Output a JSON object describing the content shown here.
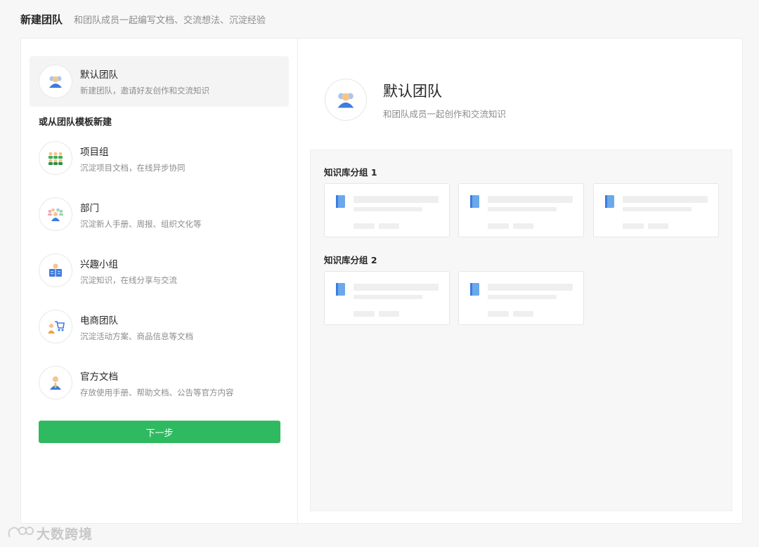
{
  "header": {
    "title": "新建团队",
    "subtitle": "和团队成员一起编写文档、交流想法、沉淀经验"
  },
  "default_team": {
    "title": "默认团队",
    "desc": "新建团队，邀请好友创作和交流知识",
    "icon": "team-icon"
  },
  "templates_label": "或从团队模板新建",
  "templates": [
    {
      "title": "项目组",
      "desc": "沉淀项目文档，在线异步协同",
      "icon": "project-group-icon"
    },
    {
      "title": "部门",
      "desc": "沉淀新人手册、周报、组织文化等",
      "icon": "department-icon"
    },
    {
      "title": "兴趣小组",
      "desc": "沉淀知识，在线分享与交流",
      "icon": "reading-icon"
    },
    {
      "title": "电商团队",
      "desc": "沉淀活动方案、商品信息等文档",
      "icon": "shopping-cart-icon"
    },
    {
      "title": "官方文档",
      "desc": "存放使用手册、帮助文档、公告等官方内容",
      "icon": "official-person-icon"
    }
  ],
  "next_label": "下一步",
  "preview": {
    "title": "默认团队",
    "desc": "和团队成员一起创作和交流知识",
    "groups": [
      {
        "label": "知识库分组 1",
        "cards": 3
      },
      {
        "label": "知识库分组 2",
        "cards": 2
      }
    ]
  },
  "watermark": "大数跨境",
  "colors": {
    "primary_green": "#2fba61",
    "book_blue": "#6aa8ec",
    "selected_bg": "#f4f4f4"
  }
}
